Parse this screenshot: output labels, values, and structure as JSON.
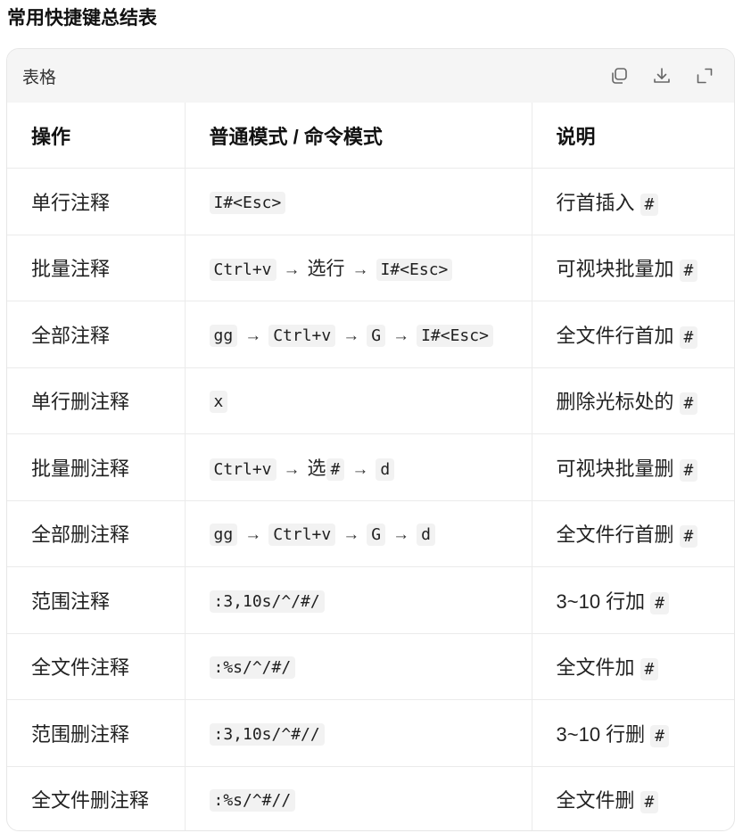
{
  "page_title": "常用快捷键总结表",
  "card": {
    "title": "表格",
    "icons": [
      "copy-icon",
      "download-icon",
      "expand-icon"
    ]
  },
  "table": {
    "headers": [
      "操作",
      "普通模式 / 命令模式",
      "说明"
    ],
    "rows": [
      {
        "action": "单行注释",
        "seq": [
          {
            "t": "code",
            "v": "I#<Esc>"
          }
        ],
        "desc": "行首插入",
        "desc_code": "#"
      },
      {
        "action": "批量注释",
        "seq": [
          {
            "t": "code",
            "v": "Ctrl+v"
          },
          {
            "t": "arrow",
            "v": "→"
          },
          {
            "t": "text",
            "v": "选行"
          },
          {
            "t": "arrow",
            "v": "→"
          },
          {
            "t": "code",
            "v": "I#<Esc>"
          }
        ],
        "desc": "可视块批量加",
        "desc_code": "#"
      },
      {
        "action": "全部注释",
        "seq": [
          {
            "t": "code",
            "v": "gg"
          },
          {
            "t": "arrow",
            "v": "→"
          },
          {
            "t": "code",
            "v": "Ctrl+v"
          },
          {
            "t": "arrow",
            "v": "→"
          },
          {
            "t": "code",
            "v": "G"
          },
          {
            "t": "arrow",
            "v": "→"
          },
          {
            "t": "code",
            "v": "I#<Esc>"
          }
        ],
        "desc": "全文件行首加",
        "desc_code": "#"
      },
      {
        "action": "单行删注释",
        "seq": [
          {
            "t": "code",
            "v": "x"
          }
        ],
        "desc": "删除光标处的",
        "desc_code": "#"
      },
      {
        "action": "批量删注释",
        "seq": [
          {
            "t": "code",
            "v": "Ctrl+v"
          },
          {
            "t": "arrow",
            "v": "→"
          },
          {
            "t": "text",
            "v": "选"
          },
          {
            "t": "code",
            "v": "#"
          },
          {
            "t": "arrow",
            "v": "→"
          },
          {
            "t": "code",
            "v": "d"
          }
        ],
        "desc": "可视块批量删",
        "desc_code": "#"
      },
      {
        "action": "全部删注释",
        "seq": [
          {
            "t": "code",
            "v": "gg"
          },
          {
            "t": "arrow",
            "v": "→"
          },
          {
            "t": "code",
            "v": "Ctrl+v"
          },
          {
            "t": "arrow",
            "v": "→"
          },
          {
            "t": "code",
            "v": "G"
          },
          {
            "t": "arrow",
            "v": "→"
          },
          {
            "t": "code",
            "v": "d"
          }
        ],
        "desc": "全文件行首删",
        "desc_code": "#"
      },
      {
        "action": "范围注释",
        "seq": [
          {
            "t": "code",
            "v": ":3,10s/^/#/"
          }
        ],
        "desc": "3~10 行加",
        "desc_code": "#"
      },
      {
        "action": "全文件注释",
        "seq": [
          {
            "t": "code",
            "v": ":%s/^/#/"
          }
        ],
        "desc": "全文件加",
        "desc_code": "#"
      },
      {
        "action": "范围删注释",
        "seq": [
          {
            "t": "code",
            "v": ":3,10s/^#//"
          }
        ],
        "desc": "3~10 行删",
        "desc_code": "#"
      },
      {
        "action": "全文件删注释",
        "seq": [
          {
            "t": "code",
            "v": ":%s/^#//"
          }
        ],
        "desc": "全文件删",
        "desc_code": "#"
      }
    ]
  }
}
